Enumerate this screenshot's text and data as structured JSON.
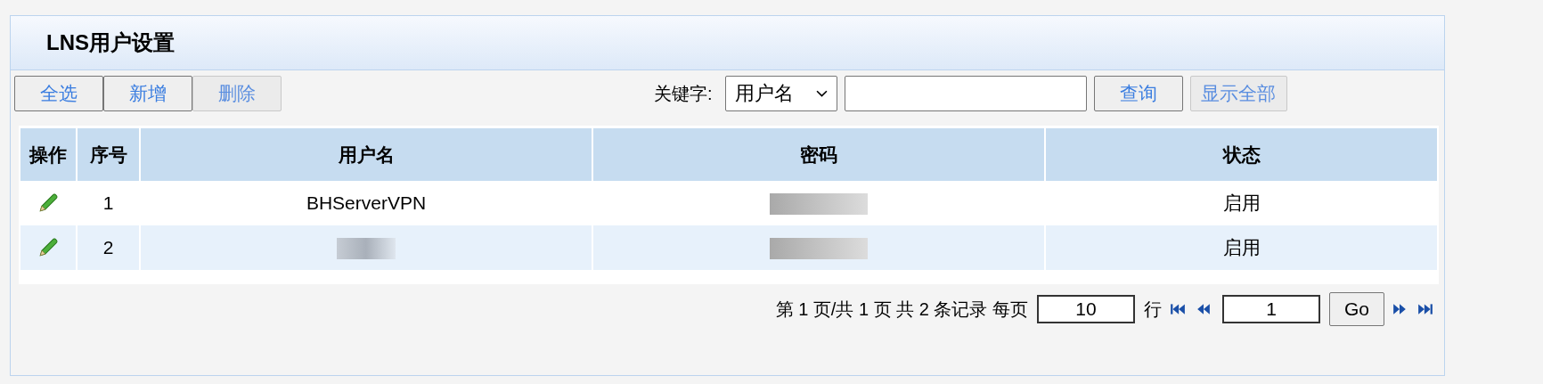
{
  "panel": {
    "title": "LNS用户设置"
  },
  "toolbar": {
    "buttons": [
      {
        "label": "全选",
        "disabled": false
      },
      {
        "label": "新增",
        "disabled": false
      },
      {
        "label": "删除",
        "disabled": true
      }
    ],
    "keyword_label": "关键字:",
    "field_select": "用户名",
    "search_button": {
      "label": "查询",
      "disabled": false
    },
    "show_all_button": {
      "label": "显示全部",
      "disabled": true
    }
  },
  "table": {
    "columns": [
      "操作",
      "序号",
      "用户名",
      "密码",
      "状态"
    ],
    "rows": [
      {
        "index": "1",
        "username": "BHServerVPN",
        "username_redacted": false,
        "password_redacted": true,
        "status": "启用"
      },
      {
        "index": "2",
        "username_redacted": true,
        "password_redacted": true,
        "status": "启用"
      }
    ]
  },
  "pagination": {
    "summary": "第 1 页/共 1 页 共 2 条记录 每页",
    "per_page": "10",
    "rows_label": "行",
    "page": "1",
    "go": "Go"
  }
}
